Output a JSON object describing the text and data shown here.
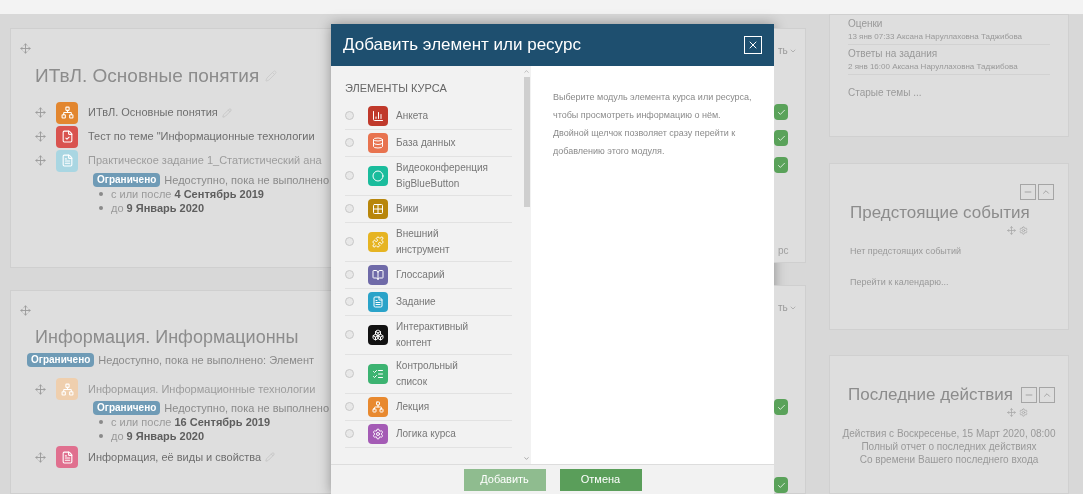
{
  "sections": [
    {
      "title": "ИТвЛ. Основные понятия",
      "menu_text": "ть",
      "trailing_text": "рс",
      "rows": [
        {
          "name": "ИТвЛ. Основные понятия",
          "color": "#e2862f",
          "dimmed": false,
          "editable": true,
          "completed": true
        },
        {
          "name": "Тест по теме \"Информационные технологии",
          "color": "#d9534f",
          "dimmed": false,
          "editable": false,
          "completed": true
        },
        {
          "name": "Практическое задание 1_Статистический ана",
          "color": "#a9d6e2",
          "dimmed": true,
          "editable": false,
          "completed": true,
          "restriction": {
            "badge": "Ограничено",
            "text": "Недоступно, пока не выполнено",
            "bullets": [
              {
                "prefix": "с или после",
                "date": "4 Сентябрь 2019"
              },
              {
                "prefix": "до",
                "date": "9 Январь 2020"
              }
            ]
          }
        }
      ]
    },
    {
      "title": "Информация. Информационны",
      "restriction": {
        "badge": "Ограничено",
        "text": "Недоступно, пока не выполнено: Элемент"
      },
      "menu_text": "ть",
      "rows": [
        {
          "name": "Информация. Информационные технологии",
          "color": "#efcfae",
          "dimmed": true,
          "editable": false,
          "completed": true,
          "restriction": {
            "badge": "Ограничено",
            "text": "Недоступно, пока не выполнено",
            "bullets": [
              {
                "prefix": "с или после",
                "date": "16 Сентябрь 2019"
              },
              {
                "prefix": "до",
                "date": "9 Январь 2020"
              }
            ]
          }
        },
        {
          "name": "Информация, её виды и свойства",
          "color": "#e0708f",
          "dimmed": false,
          "editable": true,
          "completed": true
        }
      ]
    }
  ],
  "modal": {
    "title": "Добавить элемент или ресурс",
    "list_heading": "ЭЛЕМЕНТЫ КУРСА",
    "items": [
      {
        "label": "Анкета",
        "color": "#c0392b",
        "selected": false
      },
      {
        "label": "База данных",
        "color": "#e8734f",
        "selected": false
      },
      {
        "label": "Видеоконференция BigBlueButton",
        "color": "#1abc9c",
        "selected": false
      },
      {
        "label": "Вики",
        "color": "#b8860b",
        "selected": false
      },
      {
        "label": "Внешний инструмент",
        "color": "#e6b422",
        "selected": false
      },
      {
        "label": "Глоссарий",
        "color": "#6f6aa8",
        "selected": false
      },
      {
        "label": "Задание",
        "color": "#2aa3c9",
        "selected": false
      },
      {
        "label": "Интерактивный контент",
        "color": "#111111",
        "selected": false
      },
      {
        "label": "Контрольный список",
        "color": "#3cb371",
        "selected": false
      },
      {
        "label": "Лекция",
        "color": "#e8892f",
        "selected": false
      },
      {
        "label": "Логика курса",
        "color": "#a45bb5",
        "selected": false
      }
    ],
    "description": "Выберите модуль элемента курса или ресурса, чтобы просмотреть информацию о нём. Двойной щелчок позволяет сразу перейти к добавлению этого модуля.",
    "buttons": [
      {
        "label": "Добавить",
        "disabled": true
      },
      {
        "label": "Отмена",
        "disabled": false
      }
    ]
  },
  "sidebar": {
    "recent": {
      "groups": [
        {
          "heading": "Оценки",
          "entry": "13 янв 07:33 Аксана Наруллаховна Таджибова"
        },
        {
          "heading": "Ответы на задания",
          "entry": "2 янв 16:00 Аксана Наруллаховна Таджибова"
        }
      ],
      "link": "Старые темы ..."
    },
    "events": {
      "title": "Предстоящие события",
      "empty": "Нет предстоящих событий",
      "link": "Перейти к календарю..."
    },
    "activity": {
      "title": "Последние действия",
      "since": "Действия с Воскресенье, 15 Март 2020, 08:00",
      "report": "Полный отчет о последних действиях",
      "note": "Со времени Вашего последнего входа"
    }
  }
}
